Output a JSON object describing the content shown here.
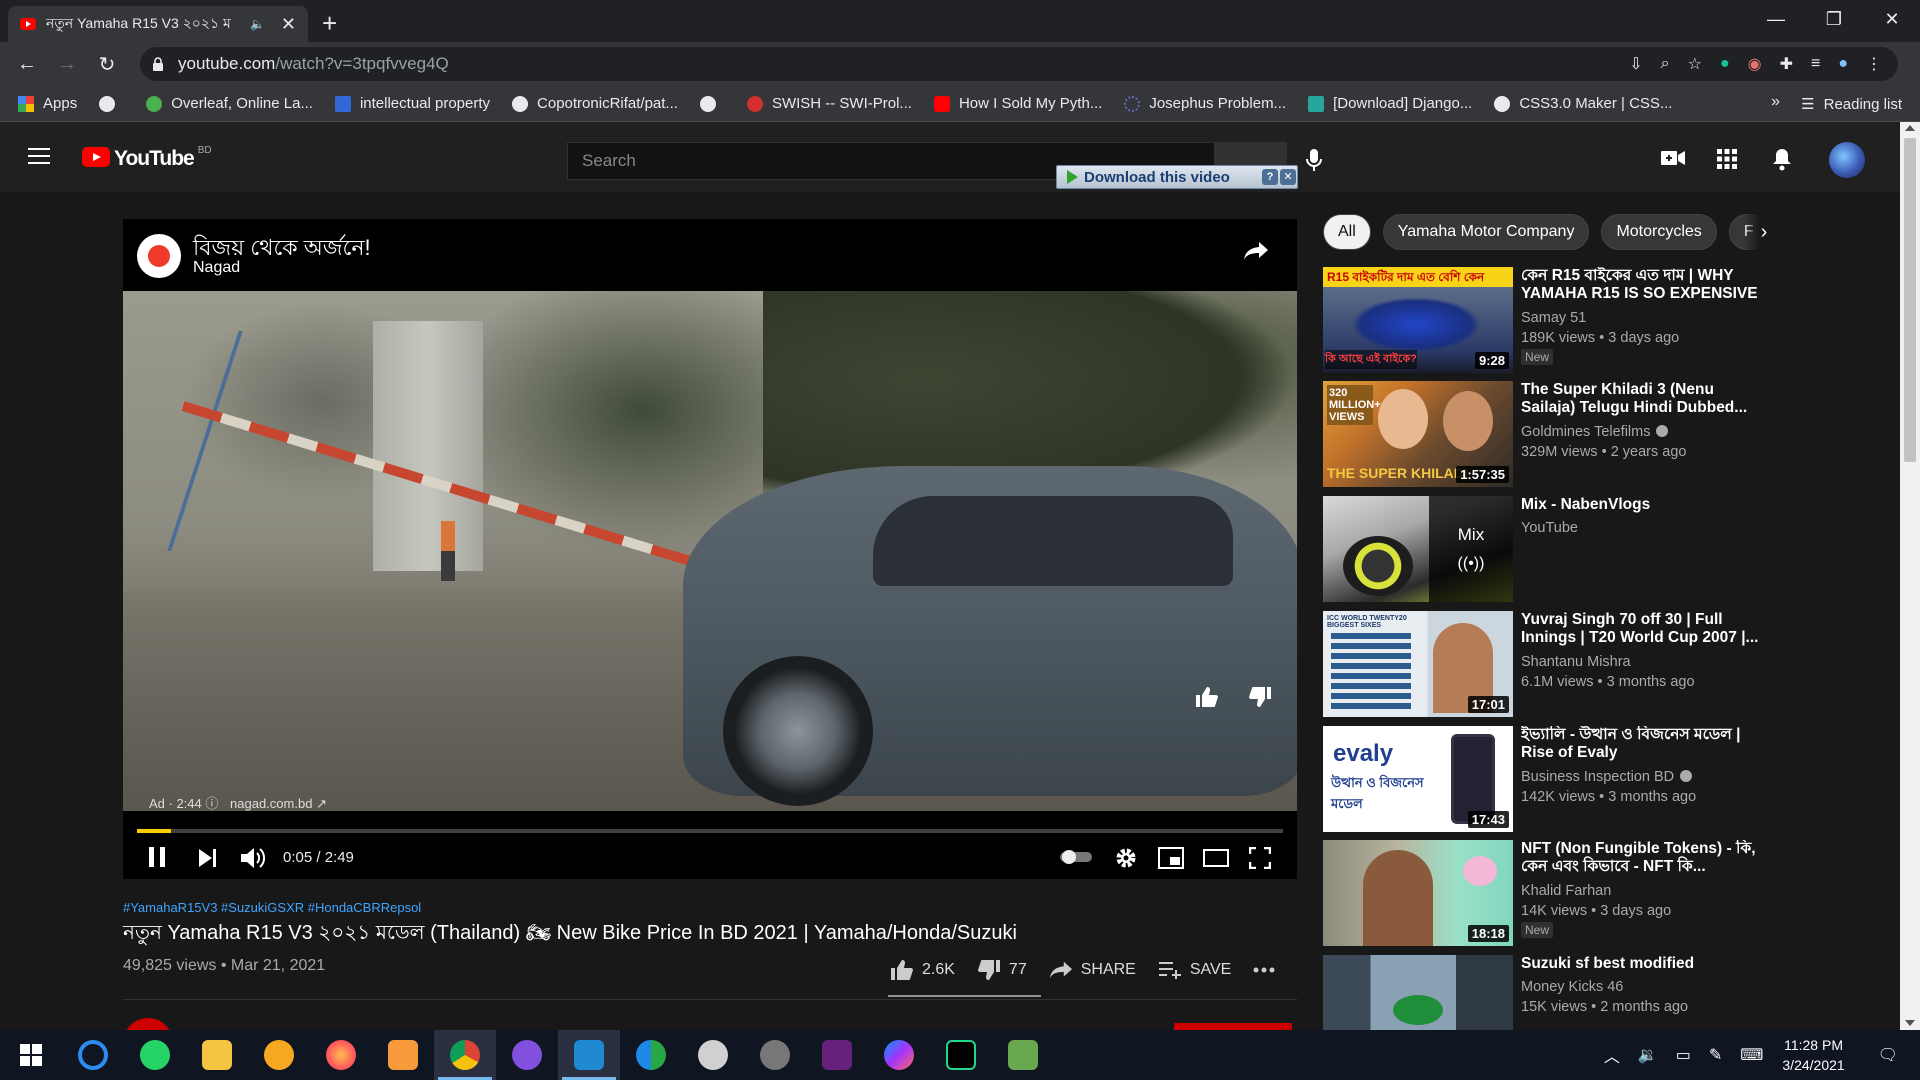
{
  "browser": {
    "tab_title": "নতুন Yamaha R15 V3 ২০২১ ম",
    "url_host": "youtube.com",
    "url_path": "/watch?v=3tpqfvveg4Q",
    "bookmarks": [
      {
        "label": "Apps",
        "color": "#ea4335"
      },
      {
        "label": "",
        "color": "#e8eaed"
      },
      {
        "label": "Overleaf, Online La...",
        "color": "#4caf50"
      },
      {
        "label": "intellectual property",
        "color": "#3367d6"
      },
      {
        "label": "CopotronicRifat/pat...",
        "color": "#e8eaed"
      },
      {
        "label": "",
        "color": "#e8eaed"
      },
      {
        "label": "SWISH -- SWI-Prol...",
        "color": "#d32f2f"
      },
      {
        "label": "How I Sold My Pyth...",
        "color": "#ff0000"
      },
      {
        "label": "Josephus Problem...",
        "color": "#5c6bc0"
      },
      {
        "label": "[Download] Django...",
        "color": "#26a69a"
      },
      {
        "label": "CSS3.0 Maker | CSS...",
        "color": "#e8eaed"
      }
    ],
    "bookmarks_more": "»",
    "reading_list": "Reading list"
  },
  "youtube": {
    "logo_text": "YouTube",
    "country_code": "BD",
    "search_placeholder": "Search",
    "download_button": "Download this video",
    "download_help": "?",
    "download_close": "✕"
  },
  "ad": {
    "title": "বিজয় থেকে অর্জনে!",
    "brand": "Nagad",
    "info": "Ad · 2:44",
    "link": "nagad.com.bd",
    "progress_fraction": 0.03
  },
  "player": {
    "time": "0:05 / 2:49"
  },
  "video": {
    "hashtags": "#YamahaR15V3 #SuzukiGSXR #HondaCBRRepsol",
    "title": "নতুন Yamaha R15 V3 ২০২১ মডেল (Thailand) 🏍 New Bike Price In BD 2021 | Yamaha/Honda/Suzuki",
    "views_date": "49,825 views • Mar 21, 2021",
    "likes": "2.6K",
    "dislikes": "77",
    "share": "SHARE",
    "save": "SAVE"
  },
  "chips": [
    "All",
    "Yamaha Motor Company",
    "Motorcycles",
    "F"
  ],
  "recommendations": [
    {
      "title": "কেন R15 বাইকের এত দাম | WHY YAMAHA R15 IS SO EXPENSIVE",
      "channel": "Samay 51",
      "meta": "189K views • 3 days ago",
      "duration": "9:28",
      "badge": "New",
      "verified": false,
      "thumb_caption": "R15 বাইকটির দাম এত বেশি কেন",
      "thumb_caption2": "কি আছে এই বাইকে?"
    },
    {
      "title": "The Super Khiladi 3 (Nenu Sailaja) Telugu Hindi Dubbed...",
      "channel": "Goldmines Telefilms",
      "meta": "329M views • 2 years ago",
      "duration": "1:57:35",
      "badge": "",
      "verified": true,
      "thumb_caption": "320 MILLION+ VIEWS",
      "thumb_caption2": "THE SUPER KHILADI"
    },
    {
      "title": "Mix - NabenVlogs",
      "channel": "YouTube",
      "meta": "",
      "duration": "",
      "badge": "",
      "verified": false,
      "mix_label": "Mix"
    },
    {
      "title": "Yuvraj Singh 70 off 30 | Full Innings | T20 World Cup 2007 |...",
      "channel": "Shantanu Mishra",
      "meta": "6.1M views • 3 months ago",
      "duration": "17:01",
      "badge": "",
      "verified": false,
      "thumb_caption": "ICC WORLD TWENTY20 BIGGEST SIXES"
    },
    {
      "title": "ইভ্যালি - উত্থান ও বিজনেস মডেল | Rise of Evaly",
      "channel": "Business Inspection BD",
      "meta": "142K views • 3 months ago",
      "duration": "17:43",
      "badge": "",
      "verified": true,
      "thumb_caption": "evaly",
      "thumb_caption2": "উত্থান ও বিজনেস মডেল"
    },
    {
      "title": "NFT (Non Fungible Tokens) - কি, কেন এবং কিভাবে - NFT কি...",
      "channel": "Khalid Farhan",
      "meta": "14K views • 3 days ago",
      "duration": "18:18",
      "badge": "New",
      "verified": false
    },
    {
      "title": "Suzuki sf best modified",
      "channel": "Money Kicks 46",
      "meta": "15K views • 2 months ago",
      "duration": "",
      "badge": "",
      "verified": false
    }
  ],
  "taskbar": {
    "time": "11:28 PM",
    "date": "3/24/2021"
  }
}
